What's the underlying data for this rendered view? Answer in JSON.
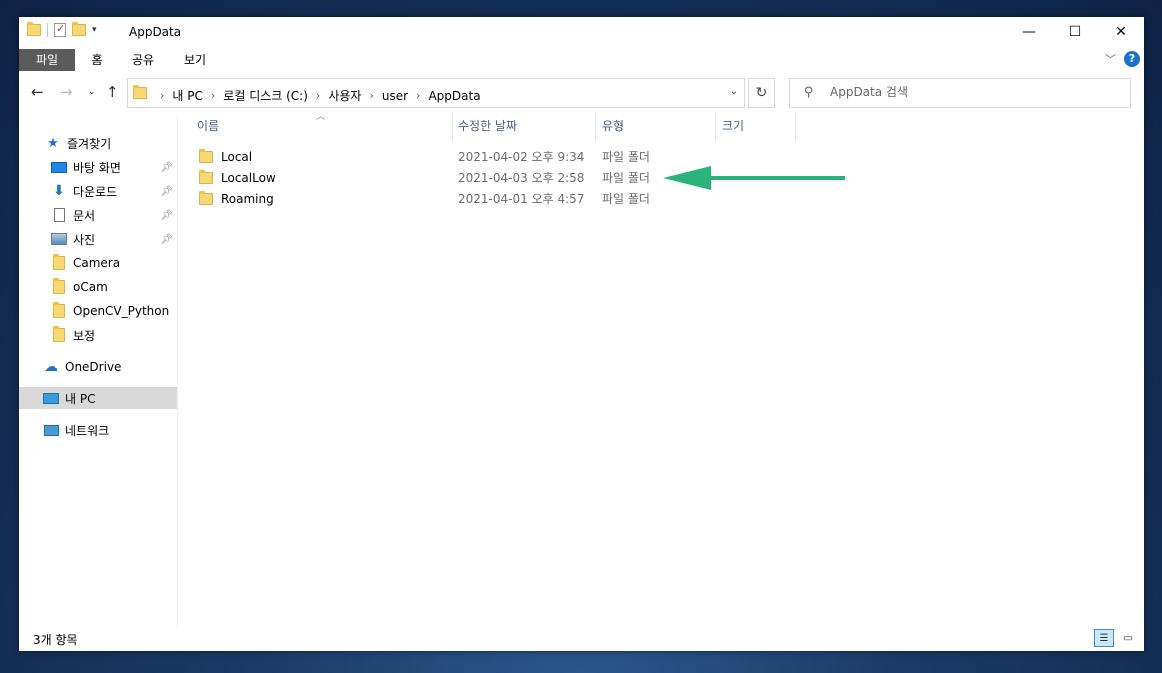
{
  "window": {
    "title": "AppData",
    "controls": [
      "—",
      "☐",
      "✕"
    ]
  },
  "ribbon": {
    "tabs": [
      "파일",
      "홈",
      "공유",
      "보기"
    ]
  },
  "address": {
    "crumbs": [
      "내 PC",
      "로컬 디스크 (C:)",
      "사용자",
      "user",
      "AppData"
    ],
    "search_placeholder": "AppData 검색"
  },
  "nav": {
    "quick_access": "즐겨찾기",
    "items": [
      {
        "label": "바탕 화면",
        "icon": "desktop-icon",
        "pinned": true
      },
      {
        "label": "다운로드",
        "icon": "download-icon",
        "pinned": true
      },
      {
        "label": "문서",
        "icon": "document-icon",
        "pinned": true
      },
      {
        "label": "사진",
        "icon": "picture-icon",
        "pinned": true
      },
      {
        "label": "Camera",
        "icon": "folder-icon",
        "pinned": false
      },
      {
        "label": "oCam",
        "icon": "folder-icon",
        "pinned": false
      },
      {
        "label": "OpenCV_Python",
        "icon": "folder-icon",
        "pinned": false
      },
      {
        "label": "보정",
        "icon": "folder-icon",
        "pinned": false
      }
    ],
    "onedrive": "OneDrive",
    "this_pc": "내 PC",
    "network": "네트워크"
  },
  "columns": {
    "name": "이름",
    "date": "수정한 날짜",
    "type": "유형",
    "size": "크기"
  },
  "files": [
    {
      "name": "Local",
      "date": "2021-04-02 오후 9:34",
      "type": "파일 폴더"
    },
    {
      "name": "LocalLow",
      "date": "2021-04-03 오후 2:58",
      "type": "파일 폴더"
    },
    {
      "name": "Roaming",
      "date": "2021-04-01 오후 4:57",
      "type": "파일 폴더"
    }
  ],
  "status": {
    "item_count": "3개 항목"
  },
  "colors": {
    "file_tab_bg": "#5b5b5b",
    "selected_nav": "#d9d9d9",
    "annotation_arrow": "#2ab27b",
    "folder": "#f8d775"
  }
}
